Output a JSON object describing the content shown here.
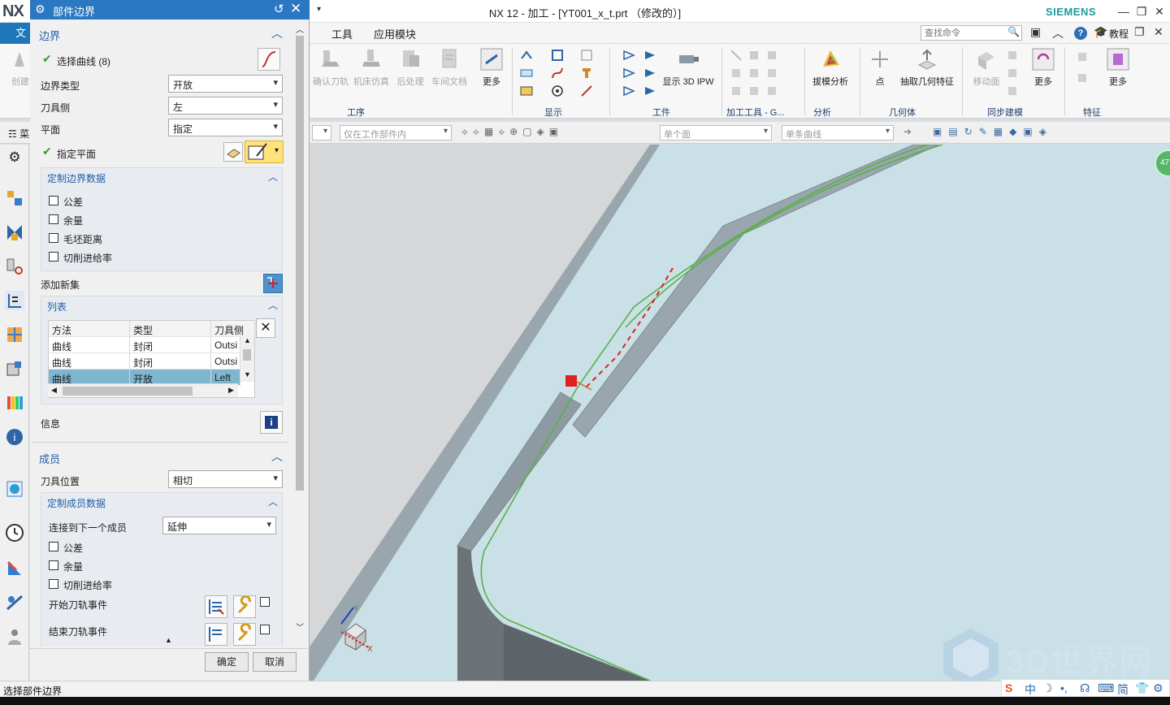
{
  "app": {
    "logo": "NX",
    "title": "NX 12 - 加工 - [YT001_x_t.prt （修改的）]",
    "brand": "SIEMENS"
  },
  "menubar": {
    "file_tab": "文",
    "items": [
      "工具",
      "应用模块"
    ],
    "search_placeholder": "查找命令",
    "tutorial": "教程"
  },
  "ribbon": {
    "buttons": {
      "create": "创建",
      "confirm_tool": "确认刀轨",
      "machine_sim": "机床仿真",
      "postprocess": "后处理",
      "shop_doc": "车间文档",
      "more1": "更多",
      "show_3d_ipw": "显示 3D IPW",
      "draft_analysis": "拔模分析",
      "point": "点",
      "extract_geometry": "抽取几何特征",
      "move_face": "移动面",
      "more2": "更多",
      "more3": "更多"
    },
    "groups": [
      "工序",
      "显示",
      "工件",
      "加工工具 - G...",
      "分析",
      "几何体",
      "同步建模",
      "特征"
    ]
  },
  "selbar": {
    "menu_prefix": "菜",
    "filter_scope": "仅在工作部件内",
    "face_rule": "单个面",
    "curve_rule": "单条曲线"
  },
  "dialog": {
    "title": "部件边界",
    "boundary": {
      "header": "边界",
      "select_curve": "选择曲线 (8)",
      "boundary_type_label": "边界类型",
      "boundary_type_value": "开放",
      "tool_side_label": "刀具侧",
      "tool_side_value": "左",
      "plane_label": "平面",
      "plane_value": "指定",
      "specify_plane": "指定平面",
      "custom_header": "定制边界数据",
      "custom_options": [
        "公差",
        "余量",
        "毛坯距离",
        "切削进给率"
      ],
      "add_new_set": "添加新集",
      "list_header": "列表",
      "columns": [
        "方法",
        "类型",
        "刀具侧"
      ],
      "rows": [
        [
          "曲线",
          "封闭",
          "Outsi"
        ],
        [
          "曲线",
          "封闭",
          "Outsi"
        ],
        [
          "曲线",
          "开放",
          "Left"
        ]
      ],
      "info": "信息"
    },
    "members": {
      "header": "成员",
      "tool_position_label": "刀具位置",
      "tool_position_value": "相切",
      "custom_header": "定制成员数据",
      "connect_label": "连接到下一个成员",
      "connect_value": "延伸",
      "custom_options": [
        "公差",
        "余量",
        "切削进给率"
      ],
      "start_event": "开始刀轨事件",
      "end_event": "结束刀轨事件"
    },
    "ok": "确定",
    "cancel": "取消"
  },
  "status": {
    "prompt": "选择部件边界"
  },
  "viewport": {
    "badge": "47",
    "axis_y": "Y",
    "axis_x": "X"
  },
  "watermark": {
    "text": "3D世界网",
    "sub": "WWW.3DSJW.COM"
  },
  "ime": {
    "items": [
      "中",
      "简"
    ]
  },
  "colors": {
    "accent": "#2b78c2",
    "brand": "#1a9b9b",
    "selected_row": "#7fb6cf",
    "viewport_bg": "#c9e0e6"
  }
}
